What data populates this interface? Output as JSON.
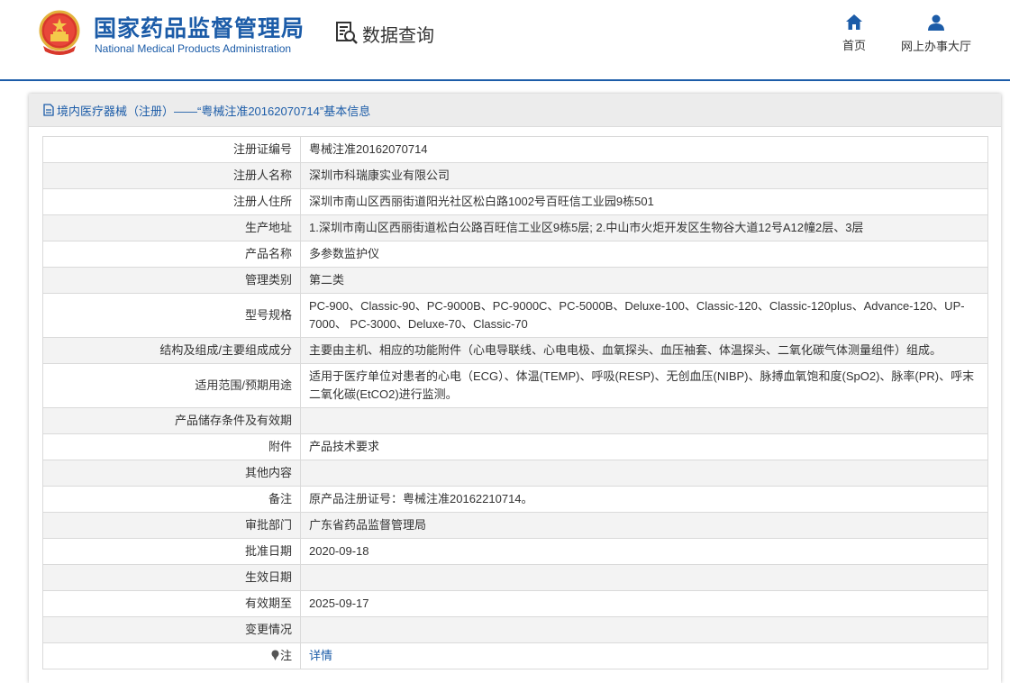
{
  "header": {
    "org_name_cn": "国家药品监督管理局",
    "org_name_en": "National Medical Products Administration",
    "data_query_label": "数据查询",
    "nav": [
      {
        "label": "首页",
        "icon": "home-icon"
      },
      {
        "label": "网上办事大厅",
        "icon": "user-icon"
      }
    ]
  },
  "panel": {
    "title": "境内医疗器械（注册）——“粤械注准20162070714”基本信息"
  },
  "rows": [
    {
      "label": "注册证编号",
      "value": "粤械注准20162070714"
    },
    {
      "label": "注册人名称",
      "value": "深圳市科瑞康实业有限公司"
    },
    {
      "label": "注册人住所",
      "value": "深圳市南山区西丽街道阳光社区松白路1002号百旺信工业园9栋501"
    },
    {
      "label": "生产地址",
      "value": "1.深圳市南山区西丽街道松白公路百旺信工业区9栋5层; 2.中山市火炬开发区生物谷大道12号A12幢2层、3层"
    },
    {
      "label": "产品名称",
      "value": "多参数监护仪"
    },
    {
      "label": "管理类别",
      "value": "第二类"
    },
    {
      "label": "型号规格",
      "value": "PC-900、Classic-90、PC-9000B、PC-9000C、PC-5000B、Deluxe-100、Classic-120、Classic-120plus、Advance-120、UP-7000、 PC-3000、Deluxe-70、Classic-70"
    },
    {
      "label": "结构及组成/主要组成成分",
      "value": "主要由主机、相应的功能附件（心电导联线、心电电极、血氧探头、血压袖套、体温探头、二氧化碳气体测量组件）组成。"
    },
    {
      "label": "适用范围/预期用途",
      "value": "适用于医疗单位对患者的心电（ECG）、体温(TEMP)、呼吸(RESP)、无创血压(NIBP)、脉搏血氧饱和度(SpO2)、脉率(PR)、呼末二氧化碳(EtCO2)进行监测。"
    },
    {
      "label": "产品储存条件及有效期",
      "value": ""
    },
    {
      "label": "附件",
      "value": "产品技术要求"
    },
    {
      "label": "其他内容",
      "value": ""
    },
    {
      "label": "备注",
      "value": "原产品注册证号：粤械注准20162210714。"
    },
    {
      "label": "审批部门",
      "value": "广东省药品监督管理局"
    },
    {
      "label": "批准日期",
      "value": "2020-09-18"
    },
    {
      "label": "生效日期",
      "value": ""
    },
    {
      "label": "有效期至",
      "value": "2025-09-17"
    },
    {
      "label": "变更情况",
      "value": ""
    }
  ],
  "note_row": {
    "label": "注",
    "link_text": "详情",
    "icon": "pin-icon"
  },
  "colors": {
    "brand": "#1c5ca8",
    "row_alt": "#f3f3f3",
    "border": "#dadada"
  }
}
